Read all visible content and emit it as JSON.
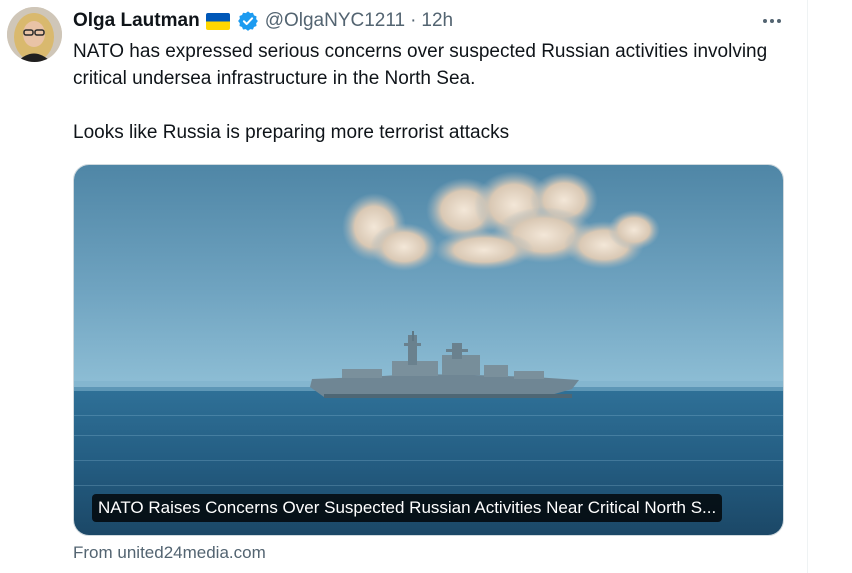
{
  "tweet": {
    "author": {
      "display_name": "Olga Lautman",
      "handle": "@OlgaNYC1211",
      "time": "12h",
      "separator": "·",
      "flag_icon": "ukraine-flag-icon",
      "verified_icon": "verified-badge-icon"
    },
    "more_icon": "more-dots-icon",
    "text": {
      "paragraph_1": "NATO has expressed serious concerns over suspected Russian activities involving critical undersea infrastructure in the North Sea.",
      "paragraph_2": "Looks like Russia is preparing more terrorist attacks"
    },
    "card": {
      "title": "NATO Raises Concerns Over Suspected Russian Activities Near Critical North S...",
      "source": "From united24media.com"
    }
  },
  "colors": {
    "verified_blue": "#1d9bf0",
    "flag_blue": "#0057b7",
    "flag_yellow": "#ffd700",
    "secondary_text": "#536471"
  }
}
